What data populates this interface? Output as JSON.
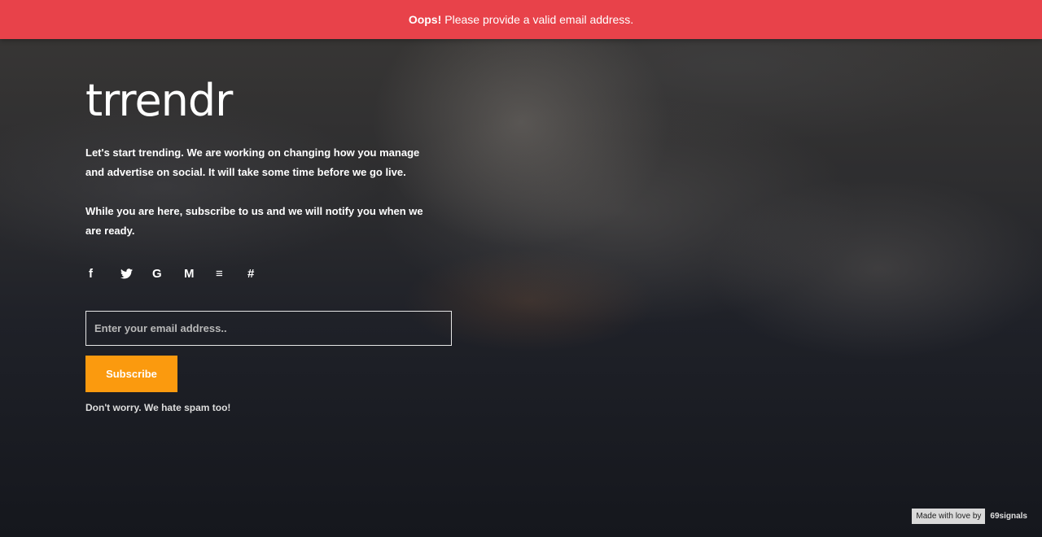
{
  "alert": {
    "prefix": "Oops!",
    "message": "Please provide a valid email address.",
    "color": "#e8424a"
  },
  "brand": {
    "logo_text": "trrendr"
  },
  "intro": {
    "paragraph_1": "Let's start trending. We are working on changing how you manage and advertise on social. It will take some time before we go live.",
    "paragraph_2": "While you are here, subscribe to us and we will notify you when we are ready."
  },
  "social": [
    {
      "name": "facebook-icon",
      "glyph": "f"
    },
    {
      "name": "twitter-icon",
      "glyph": "🐦"
    },
    {
      "name": "google-icon",
      "glyph": "G"
    },
    {
      "name": "medium-icon",
      "glyph": "M"
    },
    {
      "name": "stackoverflow-icon",
      "glyph": "≡"
    },
    {
      "name": "slack-icon",
      "glyph": "#"
    }
  ],
  "form": {
    "email_placeholder": "Enter your email address..",
    "email_value": "",
    "subscribe_label": "Subscribe",
    "subscribe_color": "#fb9a0e",
    "note": "Don't worry. We hate spam too!"
  },
  "footer": {
    "made_with": "Made with love by",
    "studio": "69signals"
  }
}
